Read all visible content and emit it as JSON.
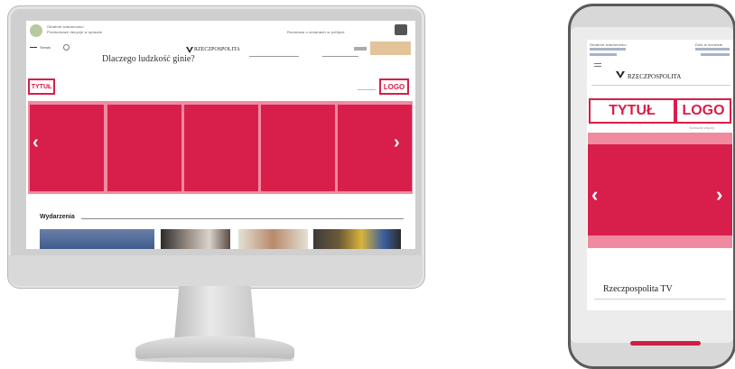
{
  "desktop": {
    "header_small_left_1": "Ostatnie wiadomości",
    "header_small_left_2": "Przełomowe decyzje w sprawie",
    "header_small_right": "Rozmowa o zmianach w polityce",
    "menu_label": "Serwis",
    "brand": "RZECZPOSPOLITA",
    "headline": "Dlaczego ludzkość ginie?",
    "title_label": "TYTUŁ",
    "logo_label": "LOGO",
    "prev_arrow": "‹",
    "next_arrow": "›",
    "section_title": "Wydarzenia",
    "colors": {
      "accent": "#d81f4b",
      "accent_light": "#f08aa0",
      "button": "#e3c39a"
    }
  },
  "mobile": {
    "header_small_left": "Ostatnie wiadomości",
    "header_small_right": "Dziś w serwisie",
    "menu_icon": "hamburger-icon",
    "brand": "RZECZPOSPOLITA",
    "title_label": "TYTUŁ",
    "logo_label": "LOGO",
    "sub_link": "Sprawdź więcej",
    "prev_arrow": "‹",
    "next_arrow": "›",
    "section_title": "Rzeczpospolita TV"
  }
}
